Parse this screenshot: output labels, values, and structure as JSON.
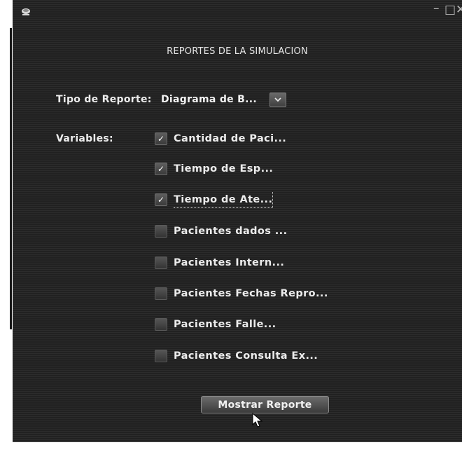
{
  "window": {
    "controls": {
      "minimize": "–",
      "maximize": "□",
      "close": "✕"
    },
    "app_icon": "java-cup-icon"
  },
  "heading": "REPORTES DE LA SIMULACION",
  "report_type": {
    "label": "Tipo de Reporte:",
    "selected": "Diagrama de B...",
    "dropdown_icon": "chevron-down-icon"
  },
  "variables": {
    "label": "Variables:",
    "items": [
      {
        "label": "Cantidad de Paci...",
        "checked": true
      },
      {
        "label": "Tiempo de Esp...",
        "checked": true
      },
      {
        "label": "Tiempo de Ate...",
        "checked": true
      },
      {
        "label": "Pacientes dados ...",
        "checked": false
      },
      {
        "label": "Pacientes Intern...",
        "checked": false
      },
      {
        "label": "Pacientes Fechas Repro...",
        "checked": false
      },
      {
        "label": "Pacientes Falle...",
        "checked": false
      },
      {
        "label": "Pacientes Consulta Ex...",
        "checked": false
      }
    ]
  },
  "action": {
    "label": "Mostrar Reporte"
  },
  "colors": {
    "background": "#262626",
    "text": "#ececec",
    "button": "#555555"
  }
}
